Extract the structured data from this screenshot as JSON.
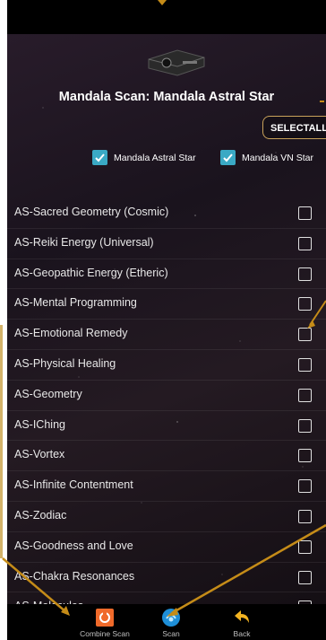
{
  "title": "Mandala Scan: Mandala Astral Star",
  "select_all_label": "SELECTALL",
  "filters": [
    {
      "label": "Mandala Astral Star",
      "checked": true
    },
    {
      "label": "Mandala VN Star",
      "checked": true
    }
  ],
  "items": [
    {
      "label": "AS-Sacred Geometry (Cosmic)",
      "checked": false
    },
    {
      "label": "AS-Reiki Energy (Universal)",
      "checked": false
    },
    {
      "label": "AS-Geopathic Energy (Etheric)",
      "checked": false
    },
    {
      "label": "AS-Mental Programming",
      "checked": false
    },
    {
      "label": "AS-Emotional Remedy",
      "checked": false
    },
    {
      "label": "AS-Physical Healing",
      "checked": false
    },
    {
      "label": "AS-Geometry",
      "checked": false
    },
    {
      "label": "AS-IChing",
      "checked": false
    },
    {
      "label": "AS-Vortex",
      "checked": false
    },
    {
      "label": "AS-Infinite Contentment",
      "checked": false
    },
    {
      "label": "AS-Zodiac",
      "checked": false
    },
    {
      "label": "AS-Goodness and Love",
      "checked": false
    },
    {
      "label": "AS-Chakra Resonances",
      "checked": false
    },
    {
      "label": "AS-Molecules",
      "checked": false
    }
  ],
  "bottom_nav": [
    {
      "label": "Combine Scan",
      "icon": "combine-scan-icon",
      "color": "#f06a2a"
    },
    {
      "label": "Scan",
      "icon": "scan-icon",
      "color": "#1e8fd8"
    },
    {
      "label": "Back",
      "icon": "back-arrow-icon",
      "color": "#f2b321"
    }
  ],
  "accent_color": "#c9a25a",
  "checkbox_color": "#3aa9c4"
}
